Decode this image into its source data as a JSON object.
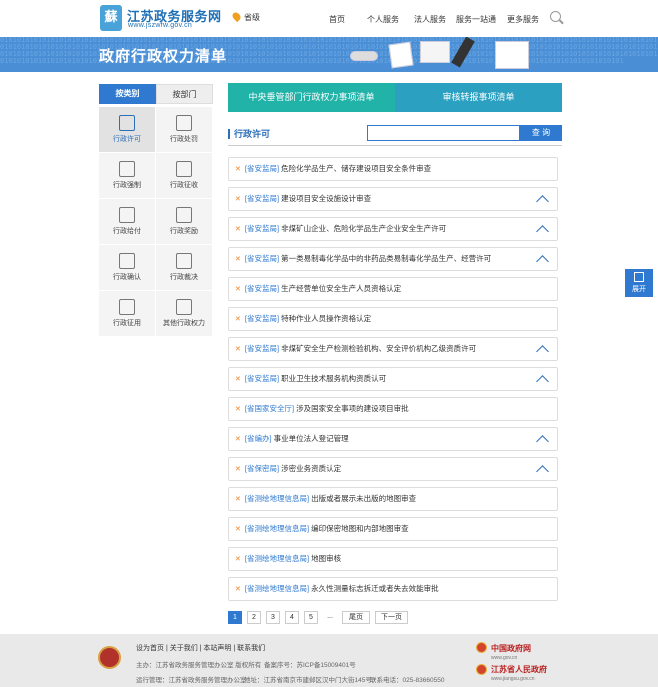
{
  "header": {
    "logo_char": "蘇",
    "site_name": "江苏政务服务网",
    "site_url": "www.jszwfw.gov.cn",
    "location": "省级",
    "nav": [
      "首页",
      "个人服务",
      "法人服务",
      "服务一站通",
      "更多服务"
    ]
  },
  "banner": {
    "title": "政府行政权力清单",
    "binary": "0101010101010101010101010101010101010101010101010101010101010101010101010101010101010101010101010101010101010101010101010101010101010101010101010101010101010101010101010101010101010101010101010101010101010101010101010101010101010101010101010101010101010101010101010101010101010101010101010101010101010101010101010101010101010101010101010101010101010101010101010101010101010101010101010101010101010101010101010101010101010101010101010101010101010101010101010101010101010101010101010101010101010101010101010101010101010101010101010101010101010101010101010101010101010101010101010101010101010101010101010101010101010101"
  },
  "left_nav": {
    "tab_category": "按类别",
    "tab_department": "按部门",
    "items": [
      {
        "label": "行政许可",
        "icon": "edit-icon"
      },
      {
        "label": "行政处罚",
        "icon": "punish-icon"
      },
      {
        "label": "行政强制",
        "icon": "force-icon"
      },
      {
        "label": "行政征收",
        "icon": "levy-icon"
      },
      {
        "label": "行政给付",
        "icon": "payment-icon"
      },
      {
        "label": "行政奖励",
        "icon": "reward-icon"
      },
      {
        "label": "行政确认",
        "icon": "confirm-icon"
      },
      {
        "label": "行政裁决",
        "icon": "gavel-icon"
      },
      {
        "label": "行政征用",
        "icon": "requisition-icon"
      },
      {
        "label": "其他行政权力",
        "icon": "grid-icon"
      }
    ]
  },
  "top_tabs": {
    "central": "中央垂管部门行政权力事项清单",
    "review": "审核转报事项清单"
  },
  "section": {
    "title": "行政许可",
    "search_button": "查 询"
  },
  "list": [
    {
      "dept": "[省安监局]",
      "name": "危险化学品生产、储存建设项目安全条件审查",
      "expand": false
    },
    {
      "dept": "[省安监局]",
      "name": "建设项目安全设施设计审查",
      "expand": true
    },
    {
      "dept": "[省安监局]",
      "name": "非煤矿山企业、危险化学品生产企业安全生产许可",
      "expand": true
    },
    {
      "dept": "[省安监局]",
      "name": "第一类易制毒化学品中的非药品类易制毒化学品生产、经营许可",
      "expand": true
    },
    {
      "dept": "[省安监局]",
      "name": "生产经营单位安全生产人员资格认定",
      "expand": false
    },
    {
      "dept": "[省安监局]",
      "name": "特种作业人员操作资格认定",
      "expand": false
    },
    {
      "dept": "[省安监局]",
      "name": "非煤矿安全生产检测检验机构、安全评价机构乙级资质许可",
      "expand": true
    },
    {
      "dept": "[省安监局]",
      "name": "职业卫生技术服务机构资质认可",
      "expand": true
    },
    {
      "dept": "[省国家安全厅]",
      "name": "涉及国家安全事项的建设项目审批",
      "expand": false
    },
    {
      "dept": "[省编办]",
      "name": "事业单位法人登记管理",
      "expand": true
    },
    {
      "dept": "[省保密局]",
      "name": "涉密业务资质认定",
      "expand": true
    },
    {
      "dept": "[省测绘地理信息局]",
      "name": "出版或者展示未出版的地图审查",
      "expand": false
    },
    {
      "dept": "[省测绘地理信息局]",
      "name": "编印保密地图和内部地图审查",
      "expand": false
    },
    {
      "dept": "[省测绘地理信息局]",
      "name": "地图审核",
      "expand": false
    },
    {
      "dept": "[省测绘地理信息局]",
      "name": "永久性测量标志拆迁或者失去效能审批",
      "expand": false
    }
  ],
  "pager": {
    "pages": [
      "1",
      "2",
      "3",
      "4",
      "5"
    ],
    "current": "1",
    "ellipsis": "...",
    "last": "尾页",
    "next": "下一页"
  },
  "float_button": {
    "label": "展开"
  },
  "footer": {
    "links": "设为首页  |  关于我们  |  本站声明  |  联系我们",
    "sponsor": "主办：江苏省政务服务管理办公室 版权所有",
    "icp": "备案序号：苏ICP备15009401号",
    "operator": "运行管理：江苏省政务服务管理办公室",
    "address": "地址：江苏省南京市建邺区汉中门大街145号",
    "phone": "联系电话：025-83660550",
    "gov_cn": "中国政府网",
    "gov_cn_url": "www.gov.cn",
    "js_gov": "江苏省人民政府",
    "js_gov_url": "www.jiangsu.gov.cn"
  }
}
